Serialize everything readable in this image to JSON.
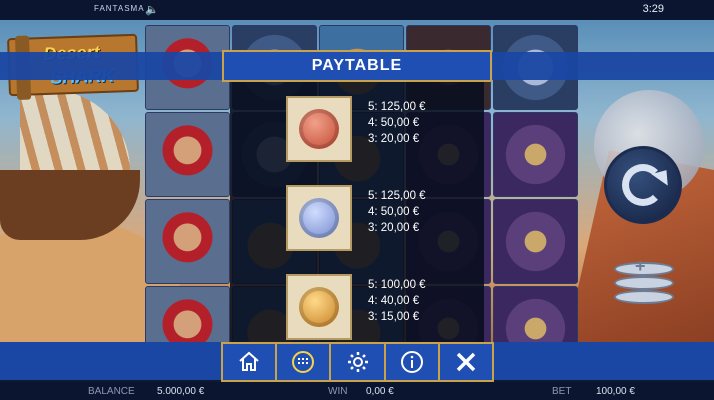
{
  "status_bar": {
    "brand": "FANTASMA",
    "sound_icon": "speaker-icon",
    "time": "3:29"
  },
  "logo": {
    "line1": "Desert",
    "line2": "SHARK"
  },
  "paytable": {
    "title": "PAYTABLE",
    "rows": [
      {
        "symbol": "red-coin-icon",
        "pays": [
          "5:  125,00 €",
          "4:  50,00 €",
          "3:  20,00 €"
        ]
      },
      {
        "symbol": "blue-coin-icon",
        "pays": [
          "5:  125,00 €",
          "4:  50,00 €",
          "3:  20,00 €"
        ]
      },
      {
        "symbol": "gold-coin-icon",
        "pays": [
          "5:  100,00 €",
          "4:  40,00 €",
          "3:  15,00 €"
        ]
      }
    ]
  },
  "menu": {
    "items": [
      "home-icon",
      "grid-icon",
      "gear-icon",
      "info-icon",
      "close-icon"
    ]
  },
  "footer": {
    "balance_label": "BALANCE",
    "balance_value": "5.000,00 €",
    "win_label": "WIN",
    "win_value": "0,00 €",
    "bet_label": "BET",
    "bet_value": "100,00 €"
  },
  "colors": {
    "accent_gold": "#c9a24a",
    "panel_blue": "#1f4fb3"
  }
}
